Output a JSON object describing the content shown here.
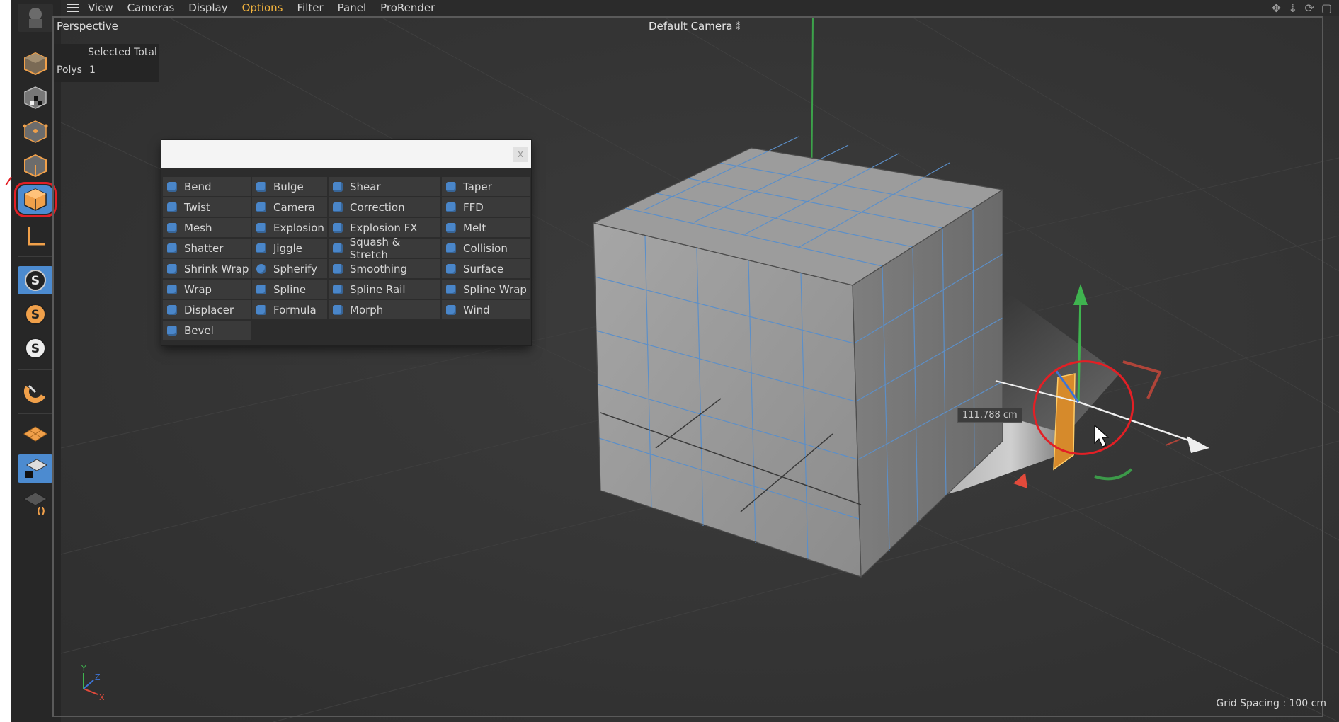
{
  "menu": {
    "items": [
      "View",
      "Cameras",
      "Display",
      "Options",
      "Filter",
      "Panel",
      "ProRender"
    ],
    "highlighted": "Options"
  },
  "palette": {
    "active_index": 4,
    "buttons": [
      "model-mode-icon",
      "texture-mode-icon",
      "points-mode-icon",
      "edges-mode-icon",
      "polygons-mode-icon",
      "axis-mode-icon",
      "snap-icon",
      "snap-settings-icon",
      "snap-toggle-icon",
      "magnet-icon",
      "workplane-icon",
      "lock-workplane-icon",
      "workplane-dynamic-icon"
    ]
  },
  "viewport": {
    "name": "Perspective",
    "camera": "Default Camera",
    "hud": {
      "header": "Selected Total",
      "row_label": "Polys",
      "row_value": "1"
    },
    "measure_label": "111.788 cm",
    "grid_spacing": "Grid Spacing : 100 cm"
  },
  "popup": {
    "search_value": "",
    "close_label": "x",
    "columns": [
      [
        "Bend",
        "Twist",
        "Mesh",
        "Shatter",
        "Shrink Wrap",
        "Wrap",
        "Displacer",
        "Bevel"
      ],
      [
        "Bulge",
        "Camera",
        "Explosion",
        "Jiggle",
        "Spherify",
        "Spline",
        "Formula"
      ],
      [
        "Shear",
        "Correction",
        "Explosion FX",
        "Squash & Stretch",
        "Smoothing",
        "Spline Rail",
        "Morph"
      ],
      [
        "Taper",
        "FFD",
        "Melt",
        "Collision",
        "Surface",
        "Spline Wrap",
        "Wind"
      ]
    ]
  },
  "colors": {
    "accent_highlight": "#f2b33d",
    "annotation_red": "#e31f25",
    "axis_x": "#e24a3b",
    "axis_y": "#3fb34f",
    "axis_z": "#3d74d6",
    "selected_polygon": "#d68a2b"
  }
}
